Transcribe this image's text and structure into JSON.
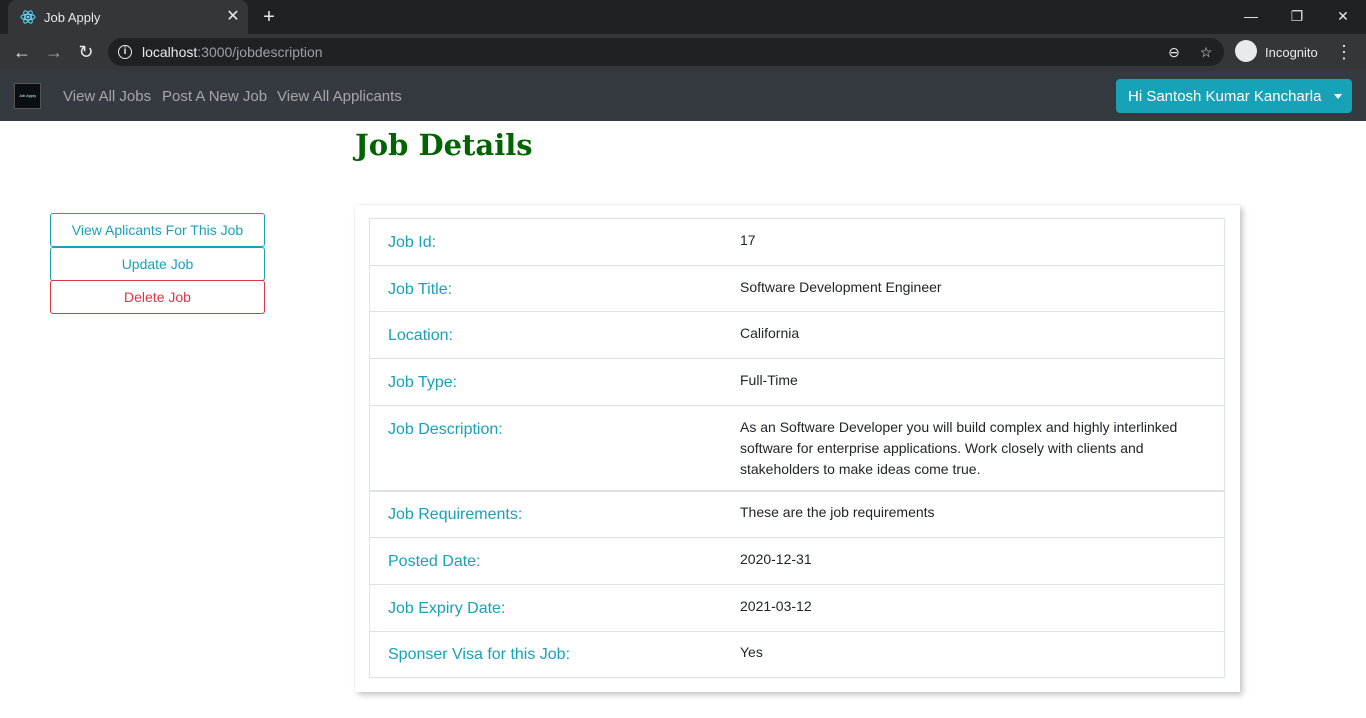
{
  "browser": {
    "tab_title": "Job Apply",
    "url_host": "localhost",
    "url_rest": ":3000/jobdescription",
    "profile_label": "Incognito"
  },
  "navbar": {
    "brand_text": "Job Apply",
    "links": [
      "View All Jobs",
      "Post A New Job",
      "View All Applicants"
    ],
    "user_button": "Hi Santosh Kumar Kancharla"
  },
  "page": {
    "title": "Job Details"
  },
  "actions": {
    "view_applicants": "View Aplicants For This Job",
    "update": "Update Job",
    "delete": "Delete Job"
  },
  "details": [
    {
      "label": "Job Id:",
      "value": "17"
    },
    {
      "label": "Job Title:",
      "value": "Software Development Engineer"
    },
    {
      "label": "Location:",
      "value": "California"
    },
    {
      "label": "Job Type:",
      "value": "Full-Time"
    },
    {
      "label": "Job Description:",
      "value": "As an Software Developer you will build complex and highly interlinked software for enterprise applications. Work closely with clients and stakeholders to make ideas come true."
    },
    {
      "label": "Job Requirements:",
      "value": "These are the job requirements"
    },
    {
      "label": "Posted Date:",
      "value": "2020-12-31"
    },
    {
      "label": "Job Expiry Date:",
      "value": "2021-03-12"
    },
    {
      "label": "Sponser Visa for this Job:",
      "value": "Yes"
    }
  ],
  "colors": {
    "accent": "#17a2b8",
    "danger": "#dc3545",
    "title_green": "#006400",
    "navbar": "#343a40"
  }
}
